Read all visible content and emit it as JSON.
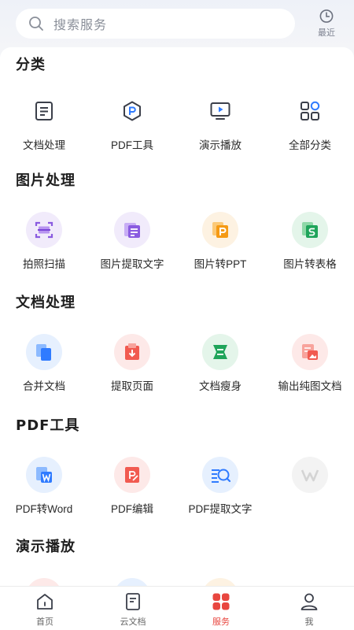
{
  "search": {
    "placeholder": "搜索服务",
    "icon": "search-icon"
  },
  "recent": {
    "label": "最近",
    "icon": "clock-icon"
  },
  "colors": {
    "accent": "#e8463f",
    "panel": "#ffffff",
    "background": "#f4f5f8"
  },
  "sections": [
    {
      "title": "分类",
      "items": [
        {
          "label": "文档处理",
          "icon": "document-icon"
        },
        {
          "label": "PDF工具",
          "icon": "pdf-hexagon-icon"
        },
        {
          "label": "演示播放",
          "icon": "presentation-play-icon"
        },
        {
          "label": "全部分类",
          "icon": "all-categories-icon"
        }
      ]
    },
    {
      "title": "图片处理",
      "items": [
        {
          "label": "拍照扫描",
          "icon": "scan-icon"
        },
        {
          "label": "图片提取文字",
          "icon": "image-text-extract-icon"
        },
        {
          "label": "图片转PPT",
          "icon": "image-to-ppt-icon"
        },
        {
          "label": "图片转表格",
          "icon": "image-to-sheet-icon"
        }
      ]
    },
    {
      "title": "文档处理",
      "items": [
        {
          "label": "合并文档",
          "icon": "merge-document-icon"
        },
        {
          "label": "提取页面",
          "icon": "extract-page-icon"
        },
        {
          "label": "文档瘦身",
          "icon": "compress-document-icon"
        },
        {
          "label": "输出纯图文档",
          "icon": "export-image-document-icon"
        }
      ]
    },
    {
      "title": "PDF工具",
      "items": [
        {
          "label": "PDF转Word",
          "icon": "pdf-to-word-icon"
        },
        {
          "label": "PDF编辑",
          "icon": "pdf-edit-icon"
        },
        {
          "label": "PDF提取文字",
          "icon": "pdf-text-extract-icon"
        },
        {
          "label": "",
          "icon": "wps-logo-icon"
        }
      ]
    },
    {
      "title": "演示播放",
      "items": []
    }
  ],
  "tabs": [
    {
      "label": "首页",
      "icon": "home-icon",
      "active": false
    },
    {
      "label": "云文档",
      "icon": "cloud-document-icon",
      "active": false
    },
    {
      "label": "服务",
      "icon": "services-grid-icon",
      "active": true
    },
    {
      "label": "我",
      "icon": "profile-icon",
      "active": false
    }
  ]
}
